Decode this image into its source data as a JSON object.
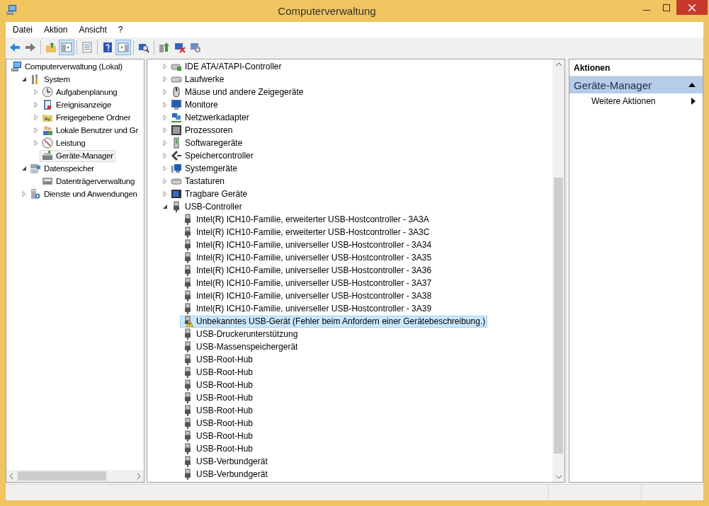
{
  "window": {
    "title": "Computerverwaltung"
  },
  "menu": [
    "Datei",
    "Aktion",
    "Ansicht",
    "?"
  ],
  "toolbar": {
    "groups": [
      {
        "buttons": [
          {
            "on": false
          },
          {
            "on": false
          }
        ]
      },
      {
        "buttons": [
          {
            "on": false
          },
          {
            "on": true
          }
        ]
      },
      {
        "buttons": [
          {
            "on": false
          }
        ]
      },
      {
        "buttons": [
          {
            "on": false
          },
          {
            "on": true
          }
        ]
      },
      {
        "buttons": [
          {
            "on": false
          }
        ]
      },
      {
        "buttons": [
          {
            "on": false
          },
          {
            "on": false
          },
          {
            "on": false
          }
        ]
      }
    ]
  },
  "console_tree": {
    "items": [
      {
        "label": "Computerverwaltung (Lokal)",
        "selected": false,
        "children": [
          {
            "label": "System",
            "expanded": true,
            "selected": false,
            "children": [
              {
                "label": "Aufgabenplanung",
                "expanded": false,
                "selected": false
              },
              {
                "label": "Ereignisanzeige",
                "expanded": false,
                "selected": false
              },
              {
                "label": "Freigegebene Ordner",
                "expanded": false,
                "selected": false
              },
              {
                "label": "Lokale Benutzer und Gr",
                "expanded": false,
                "selected": false
              },
              {
                "label": "Leistung",
                "expanded": false,
                "selected": false
              },
              {
                "label": "Geräte-Manager",
                "selected": true
              }
            ]
          },
          {
            "label": "Datenspeicher",
            "expanded": true,
            "selected": false,
            "children": [
              {
                "label": "Datenträgerverwaltung",
                "selected": false
              }
            ]
          },
          {
            "label": "Dienste und Anwendungen",
            "expanded": false,
            "selected": false
          }
        ]
      }
    ]
  },
  "device_tree": {
    "items": [
      {
        "label": "IDE ATA/ATAPI-Controller",
        "expanded": false,
        "selected": false
      },
      {
        "label": "Laufwerke",
        "expanded": false,
        "selected": false
      },
      {
        "label": "Mäuse und andere Zeigegeräte",
        "expanded": false,
        "selected": false
      },
      {
        "label": "Monitore",
        "expanded": false,
        "selected": false
      },
      {
        "label": "Netzwerkadapter",
        "expanded": false,
        "selected": false
      },
      {
        "label": "Prozessoren",
        "expanded": false,
        "selected": false
      },
      {
        "label": "Softwaregeräte",
        "expanded": false,
        "selected": false
      },
      {
        "label": "Speichercontroller",
        "expanded": false,
        "selected": false
      },
      {
        "label": "Systemgeräte",
        "expanded": false,
        "selected": false
      },
      {
        "label": "Tastaturen",
        "expanded": false,
        "selected": false
      },
      {
        "label": "Tragbare Geräte",
        "expanded": false,
        "selected": false
      },
      {
        "label": "USB-Controller",
        "expanded": true,
        "selected": false,
        "children": [
          {
            "label": "Intel(R) ICH10-Familie, erweiterter USB-Hostcontroller - 3A3A",
            "selected": false,
            "warning": false
          },
          {
            "label": "Intel(R) ICH10-Familie, erweiterter USB-Hostcontroller - 3A3C",
            "selected": false,
            "warning": false
          },
          {
            "label": "Intel(R) ICH10-Familie, universeller USB-Hostcontroller - 3A34",
            "selected": false,
            "warning": false
          },
          {
            "label": "Intel(R) ICH10-Familie, universeller USB-Hostcontroller - 3A35",
            "selected": false,
            "warning": false
          },
          {
            "label": "Intel(R) ICH10-Familie, universeller USB-Hostcontroller - 3A36",
            "selected": false,
            "warning": false
          },
          {
            "label": "Intel(R) ICH10-Familie, universeller USB-Hostcontroller - 3A37",
            "selected": false,
            "warning": false
          },
          {
            "label": "Intel(R) ICH10-Familie, universeller USB-Hostcontroller - 3A38",
            "selected": false,
            "warning": false
          },
          {
            "label": "Intel(R) ICH10-Familie, universeller USB-Hostcontroller - 3A39",
            "selected": false,
            "warning": false
          },
          {
            "label": "Unbekanntes USB-Gerät (Fehler beim Anfordern einer Gerätebeschreibung.)",
            "selected": true,
            "warning": true
          },
          {
            "label": "USB-Druckerunterstützung",
            "selected": false,
            "warning": false
          },
          {
            "label": "USB-Massenspeichergerät",
            "selected": false,
            "warning": false
          },
          {
            "label": "USB-Root-Hub",
            "selected": false,
            "warning": false
          },
          {
            "label": "USB-Root-Hub",
            "selected": false,
            "warning": false
          },
          {
            "label": "USB-Root-Hub",
            "selected": false,
            "warning": false
          },
          {
            "label": "USB-Root-Hub",
            "selected": false,
            "warning": false
          },
          {
            "label": "USB-Root-Hub",
            "selected": false,
            "warning": false
          },
          {
            "label": "USB-Root-Hub",
            "selected": false,
            "warning": false
          },
          {
            "label": "USB-Root-Hub",
            "selected": false,
            "warning": false
          },
          {
            "label": "USB-Root-Hub",
            "selected": false,
            "warning": false
          },
          {
            "label": "USB-Verbundgerät",
            "selected": false,
            "warning": false
          },
          {
            "label": "USB-Verbundgerät",
            "selected": false,
            "warning": false
          }
        ]
      }
    ]
  },
  "actions": {
    "title": "Aktionen",
    "section": {
      "label": "Geräte-Manager",
      "expanded": true
    },
    "items": [
      "Weitere Aktionen"
    ]
  }
}
